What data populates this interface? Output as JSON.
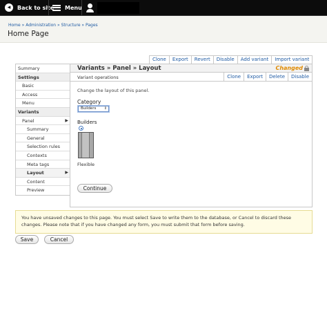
{
  "toolbar": {
    "back_label": "Back to site",
    "menu_label": "Menu"
  },
  "header": {
    "breadcrumb": "Home » Administration » Structure » Pages",
    "title": "Home Page"
  },
  "top_operations": [
    "Clone",
    "Export",
    "Revert",
    "Disable",
    "Add variant",
    "Import variant"
  ],
  "nav": [
    {
      "label": "Summary",
      "level": 0,
      "section": false
    },
    {
      "label": "Settings",
      "level": 0,
      "section": true
    },
    {
      "label": "Basic",
      "level": 1,
      "section": false
    },
    {
      "label": "Access",
      "level": 1,
      "section": false
    },
    {
      "label": "Menu",
      "level": 1,
      "section": false
    },
    {
      "label": "Variants",
      "level": 0,
      "section": true
    },
    {
      "label": "Panel",
      "level": 1,
      "section": false,
      "arrow": "▶"
    },
    {
      "label": "Summary",
      "level": 2,
      "section": false
    },
    {
      "label": "General",
      "level": 2,
      "section": false
    },
    {
      "label": "Selection rules",
      "level": 2,
      "section": false
    },
    {
      "label": "Contexts",
      "level": 2,
      "section": false
    },
    {
      "label": "Meta tags",
      "level": 2,
      "section": false
    },
    {
      "label": "Layout",
      "level": 2,
      "section": false,
      "active": true,
      "arrow": "▶"
    },
    {
      "label": "Content",
      "level": 2,
      "section": false
    },
    {
      "label": "Preview",
      "level": 2,
      "section": false
    }
  ],
  "main": {
    "title": "Variants » Panel » Layout",
    "status": "Changed",
    "variant_label": "Variant operations",
    "variant_ops": [
      "Clone",
      "Export",
      "Delete",
      "Disable"
    ],
    "description": "Change the layout of this panel.",
    "category_label": "Category",
    "category_value": "Builders",
    "builders_label": "Builders",
    "layout_name": "Flexible",
    "continue_label": "Continue"
  },
  "message": "You have unsaved changes to this page. You must select Save to write them to the database, or Cancel to discard these changes. Please note that if you have changed any form, you must submit that form before saving.",
  "actions": {
    "save_label": "Save",
    "cancel_label": "Cancel"
  },
  "colors": {
    "link": "#1e5aa3",
    "changed": "#e08a00",
    "toolbar": "#0c0c0c",
    "message_bg": "#fffce5"
  }
}
